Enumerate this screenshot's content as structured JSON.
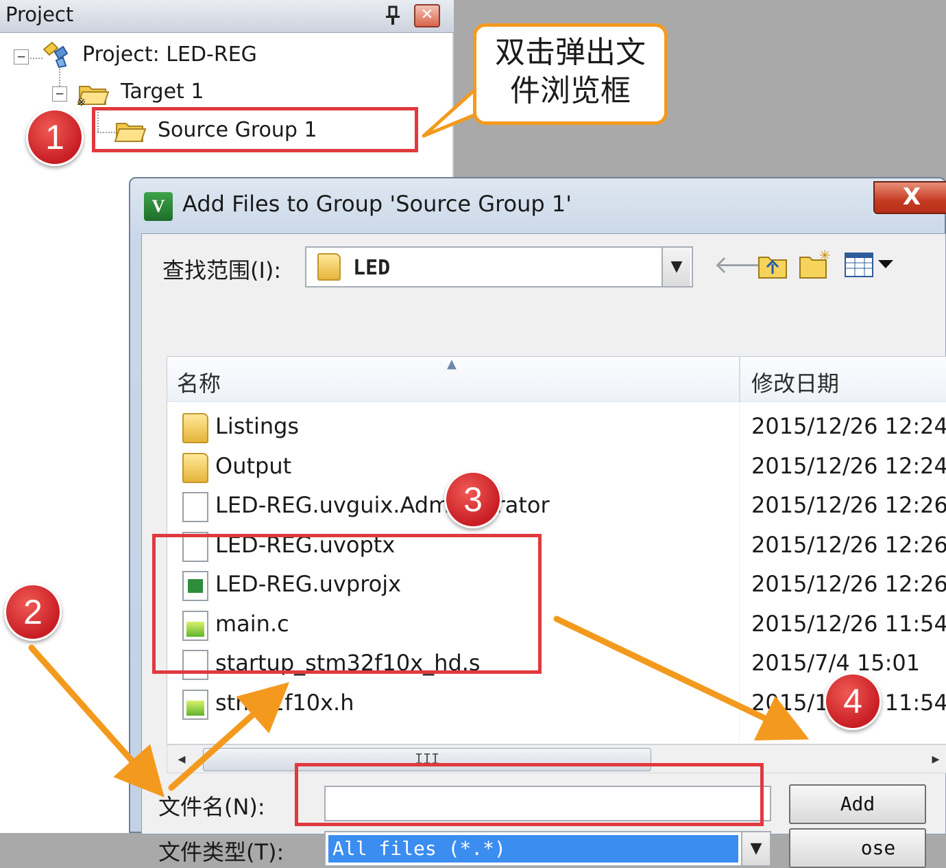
{
  "project_pane": {
    "title": "Project",
    "tree": {
      "root": "Project: LED-REG",
      "target": "Target 1",
      "group": "Source Group 1"
    }
  },
  "callout": {
    "line1": "双击弹出文",
    "line2": "件浏览框"
  },
  "badges": [
    "1",
    "2",
    "3",
    "4"
  ],
  "dialog": {
    "title": "Add Files to Group 'Source Group 1'",
    "close_label": "X",
    "look_in_label": "查找范围(I):",
    "look_in_value": "LED",
    "columns": {
      "name": "名称",
      "date": "修改日期"
    },
    "files": [
      {
        "name": "Listings",
        "date": "2015/12/26 12:24",
        "icon": "folder-icon"
      },
      {
        "name": "Output",
        "date": "2015/12/26 12:24",
        "icon": "folder-icon"
      },
      {
        "name": "LED-REG.uvguix.Administrator",
        "date": "2015/12/26 12:26",
        "icon": "file-icon"
      },
      {
        "name": "LED-REG.uvoptx",
        "date": "2015/12/26 12:26",
        "icon": "file-icon"
      },
      {
        "name": "LED-REG.uvprojx",
        "date": "2015/12/26 12:26",
        "icon": "project-file-icon"
      },
      {
        "name": "main.c",
        "date": "2015/12/26 11:54",
        "icon": "source-file-icon"
      },
      {
        "name": "startup_stm32f10x_hd.s",
        "date": "2015/7/4 15:01",
        "icon": "file-icon"
      },
      {
        "name": "stm32f10x.h",
        "date": "2015/12/26 11:54",
        "icon": "source-file-icon"
      }
    ],
    "scroll_thumb_label": "III",
    "filename_label": "文件名(N):",
    "filename_value": "",
    "filetype_label": "文件类型(T):",
    "filetype_value": "All files (*.*)",
    "add_button": "Add",
    "close_button": "ose"
  },
  "colors": {
    "highlight_red": "#e0393e",
    "arrow_orange": "#f39a1e",
    "selection_blue": "#3b8df0"
  }
}
